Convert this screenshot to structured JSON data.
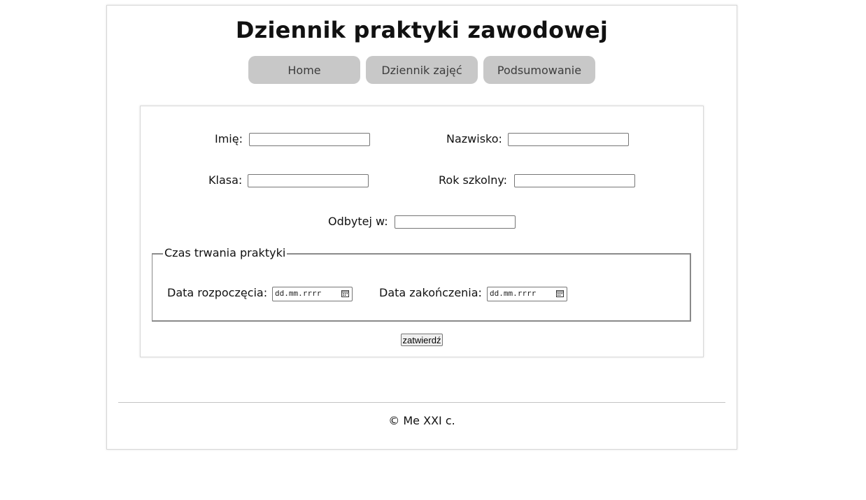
{
  "header": {
    "title": "Dziennik praktyki zawodowej"
  },
  "nav": {
    "items": [
      {
        "label": "Home"
      },
      {
        "label": "Dziennik zajęć"
      },
      {
        "label": "Podsumowanie"
      }
    ]
  },
  "form": {
    "first_name": {
      "label": "Imię:",
      "value": ""
    },
    "last_name": {
      "label": "Nazwisko:",
      "value": ""
    },
    "class": {
      "label": "Klasa:",
      "value": ""
    },
    "school_year": {
      "label": "Rok szkolny:",
      "value": ""
    },
    "place": {
      "label": "Odbytej w:",
      "value": ""
    },
    "period": {
      "legend": "Czas trwania praktyki",
      "start": {
        "label": "Data rozpoczęcia:",
        "placeholder": "dd.mm.rrrr",
        "icon": "calendar-icon"
      },
      "end": {
        "label": "Data zakończenia:",
        "placeholder": "dd.mm.rrrr",
        "icon": "calendar-icon"
      }
    },
    "submit_label": "zatwierdź"
  },
  "footer": {
    "text": "© Me XXI c."
  },
  "colors": {
    "nav_bg": "#c8c8c8",
    "nav_text": "#3d3d3d",
    "border": "#d6d6d6"
  }
}
